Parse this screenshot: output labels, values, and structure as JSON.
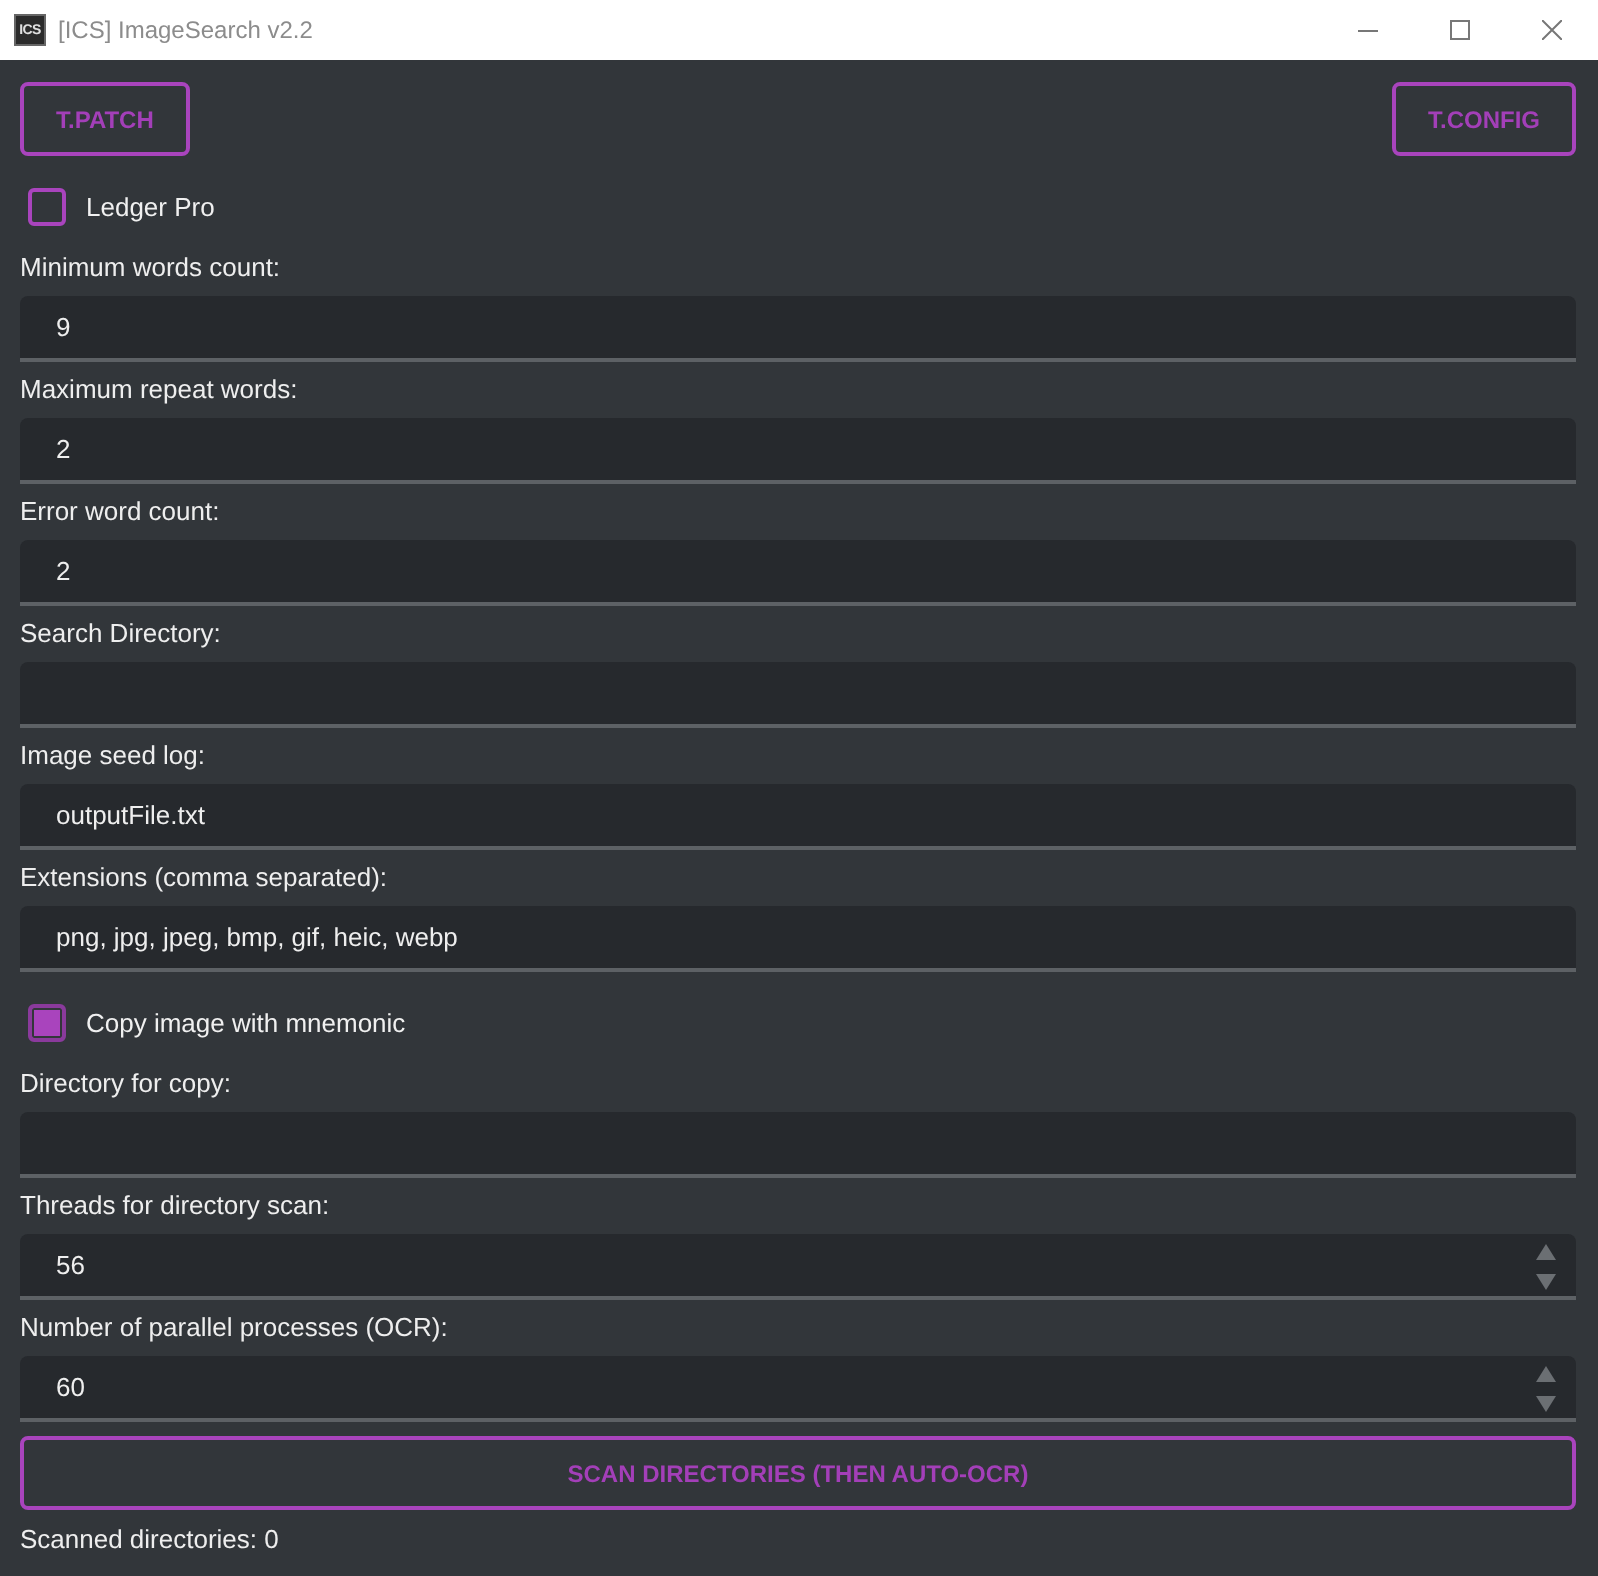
{
  "window": {
    "title": "[ICS] ImageSearch v2.2",
    "icon_text": "ICS"
  },
  "header_buttons": [
    "T.PATCH",
    "T.CONFIG"
  ],
  "form": [
    {
      "kind": "checkbox",
      "label": "Ledger Pro",
      "checked": false
    },
    {
      "kind": "text",
      "label": "Minimum words count:",
      "value": "9"
    },
    {
      "kind": "text",
      "label": "Maximum repeat words:",
      "value": "2"
    },
    {
      "kind": "text",
      "label": "Error word count:",
      "value": "2"
    },
    {
      "kind": "text",
      "label": "Search Directory:"
    },
    {
      "kind": "text",
      "label": "Image seed log:",
      "value": "outputFile.txt"
    },
    {
      "kind": "text",
      "label": "Extensions (comma separated):",
      "value": "png, jpg, jpeg, bmp, gif, heic, webp"
    },
    {
      "kind": "checkbox",
      "label": "Copy image with mnemonic",
      "checked": true
    },
    {
      "kind": "text",
      "label": "Directory for copy:"
    },
    {
      "kind": "spin",
      "label": "Threads for directory scan:",
      "value": "56"
    },
    {
      "kind": "spin",
      "label": "Number of parallel processes (OCR):",
      "value": "60"
    }
  ],
  "scan_button": "SCAN DIRECTORIES (THEN AUTO-OCR)",
  "status": "Scanned directories: 0"
}
